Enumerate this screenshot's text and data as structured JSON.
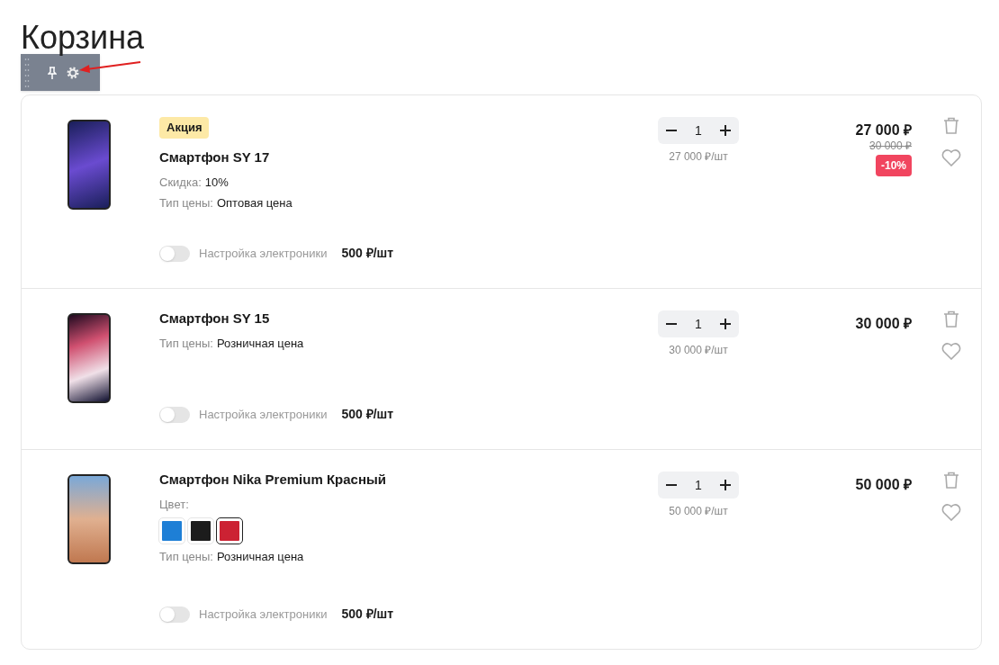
{
  "title": "Корзина",
  "items": [
    {
      "badge": "Акция",
      "name": "Смартфон SY 17",
      "props": [
        {
          "label": "Скидка:",
          "value": "10%"
        },
        {
          "label": "Тип цены:",
          "value": "Оптовая цена"
        }
      ],
      "service": {
        "label": "Настройка электроники",
        "price": "500 ₽/шт",
        "on": false
      },
      "quantity": "1",
      "unit_price": "27 000 ₽/шт",
      "price": "27 000 ₽",
      "old_price": "30 000 ₽",
      "discount": "-10%"
    },
    {
      "name": "Смартфон SY 15",
      "props": [
        {
          "label": "Тип цены:",
          "value": "Розничная цена"
        }
      ],
      "service": {
        "label": "Настройка электроники",
        "price": "500 ₽/шт",
        "on": false
      },
      "quantity": "1",
      "unit_price": "30 000 ₽/шт",
      "price": "30 000 ₽"
    },
    {
      "name": "Смартфон Nika Premium Красный",
      "color_label": "Цвет:",
      "colors": [
        {
          "color": "#1e7fd6",
          "selected": false
        },
        {
          "color": "#1c1c1c",
          "selected": false
        },
        {
          "color": "#cc2233",
          "selected": true
        }
      ],
      "props": [
        {
          "label": "Тип цены:",
          "value": "Розничная цена"
        }
      ],
      "service": {
        "label": "Настройка электроники",
        "price": "500 ₽/шт",
        "on": false
      },
      "quantity": "1",
      "unit_price": "50 000 ₽/шт",
      "price": "50 000 ₽"
    }
  ]
}
